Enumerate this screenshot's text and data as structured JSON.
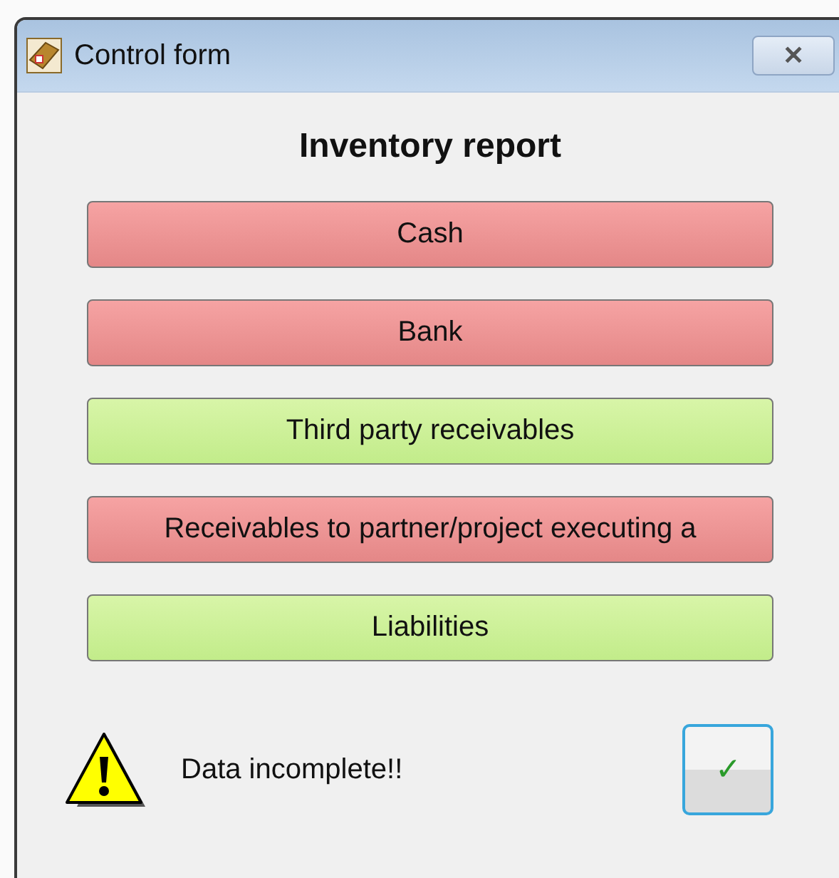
{
  "window": {
    "title": "Control form",
    "close": "✕"
  },
  "heading": "Inventory report",
  "items": [
    {
      "label": "Cash",
      "complete": false
    },
    {
      "label": "Bank",
      "complete": false
    },
    {
      "label": "Third party receivables",
      "complete": true
    },
    {
      "label": "Receivables to partner/project executing a",
      "complete": false
    },
    {
      "label": "Liabilities",
      "complete": true
    }
  ],
  "status": {
    "message": "Data incomplete!!",
    "ok": "✓"
  }
}
